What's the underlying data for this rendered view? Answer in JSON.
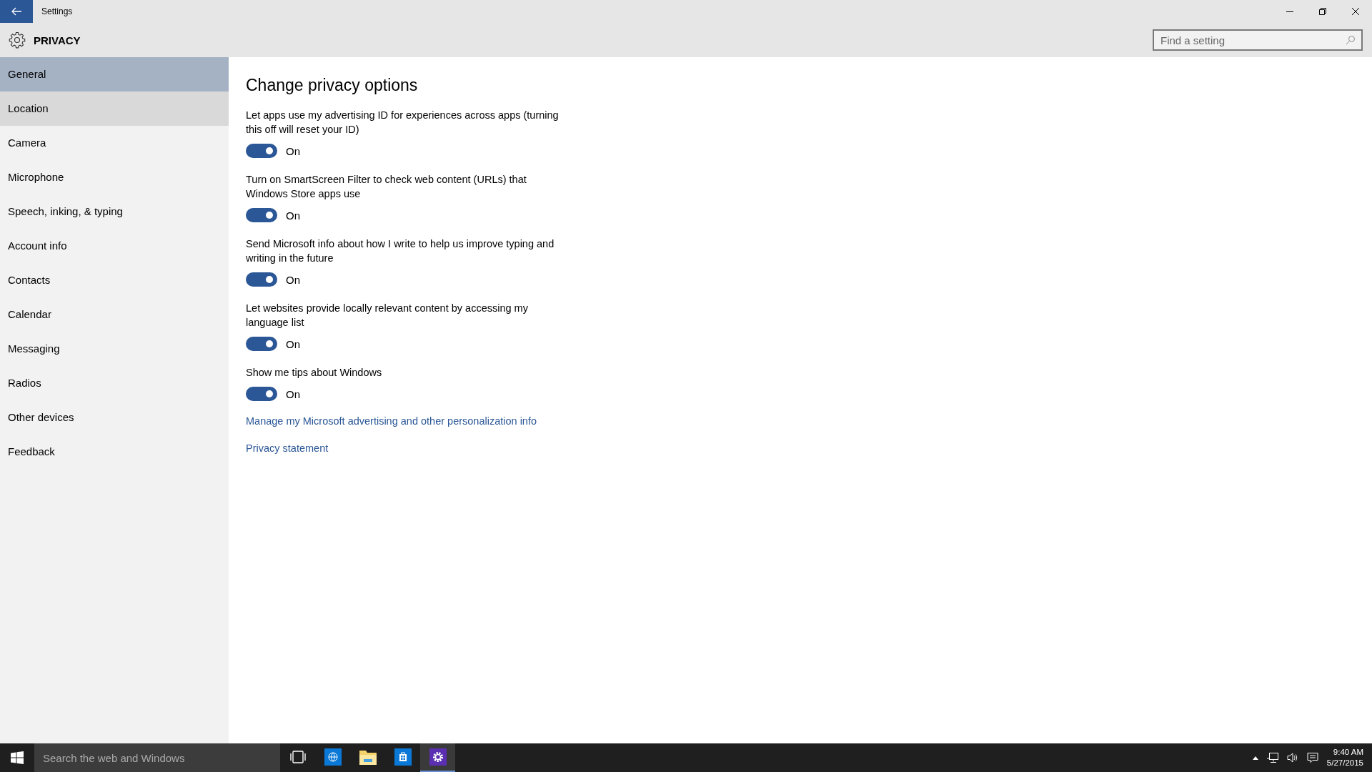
{
  "window": {
    "title": "Settings",
    "section": "PRIVACY"
  },
  "search": {
    "placeholder": "Find a setting"
  },
  "sidebar": {
    "items": [
      {
        "label": "General",
        "selected": true,
        "hovered": false
      },
      {
        "label": "Location",
        "selected": false,
        "hovered": true
      },
      {
        "label": "Camera",
        "selected": false,
        "hovered": false
      },
      {
        "label": "Microphone",
        "selected": false,
        "hovered": false
      },
      {
        "label": "Speech, inking, & typing",
        "selected": false,
        "hovered": false
      },
      {
        "label": "Account info",
        "selected": false,
        "hovered": false
      },
      {
        "label": "Contacts",
        "selected": false,
        "hovered": false
      },
      {
        "label": "Calendar",
        "selected": false,
        "hovered": false
      },
      {
        "label": "Messaging",
        "selected": false,
        "hovered": false
      },
      {
        "label": "Radios",
        "selected": false,
        "hovered": false
      },
      {
        "label": "Other devices",
        "selected": false,
        "hovered": false
      },
      {
        "label": "Feedback",
        "selected": false,
        "hovered": false
      }
    ]
  },
  "content": {
    "heading": "Change privacy options",
    "options": [
      {
        "description": "Let apps use my advertising ID for experiences across apps (turning this off will reset your ID)",
        "on": true,
        "state_label": "On"
      },
      {
        "description": "Turn on SmartScreen Filter to check web content (URLs) that Windows Store apps use",
        "on": true,
        "state_label": "On"
      },
      {
        "description": "Send Microsoft info about how I write to help us improve typing and writing in the future",
        "on": true,
        "state_label": "On"
      },
      {
        "description": "Let websites provide locally relevant content by accessing my language list",
        "on": true,
        "state_label": "On"
      },
      {
        "description": "Show me tips about Windows",
        "on": true,
        "state_label": "On"
      }
    ],
    "links": [
      "Manage my Microsoft advertising and other personalization info",
      "Privacy statement"
    ]
  },
  "taskbar": {
    "search_placeholder": "Search the web and Windows",
    "apps": [
      {
        "kind": "taskview",
        "active": false
      },
      {
        "kind": "browser",
        "active": false
      },
      {
        "kind": "explorer",
        "active": false
      },
      {
        "kind": "store",
        "active": false
      },
      {
        "kind": "settings",
        "active": true
      }
    ],
    "time": "9:40 AM",
    "date": "5/27/2015"
  }
}
